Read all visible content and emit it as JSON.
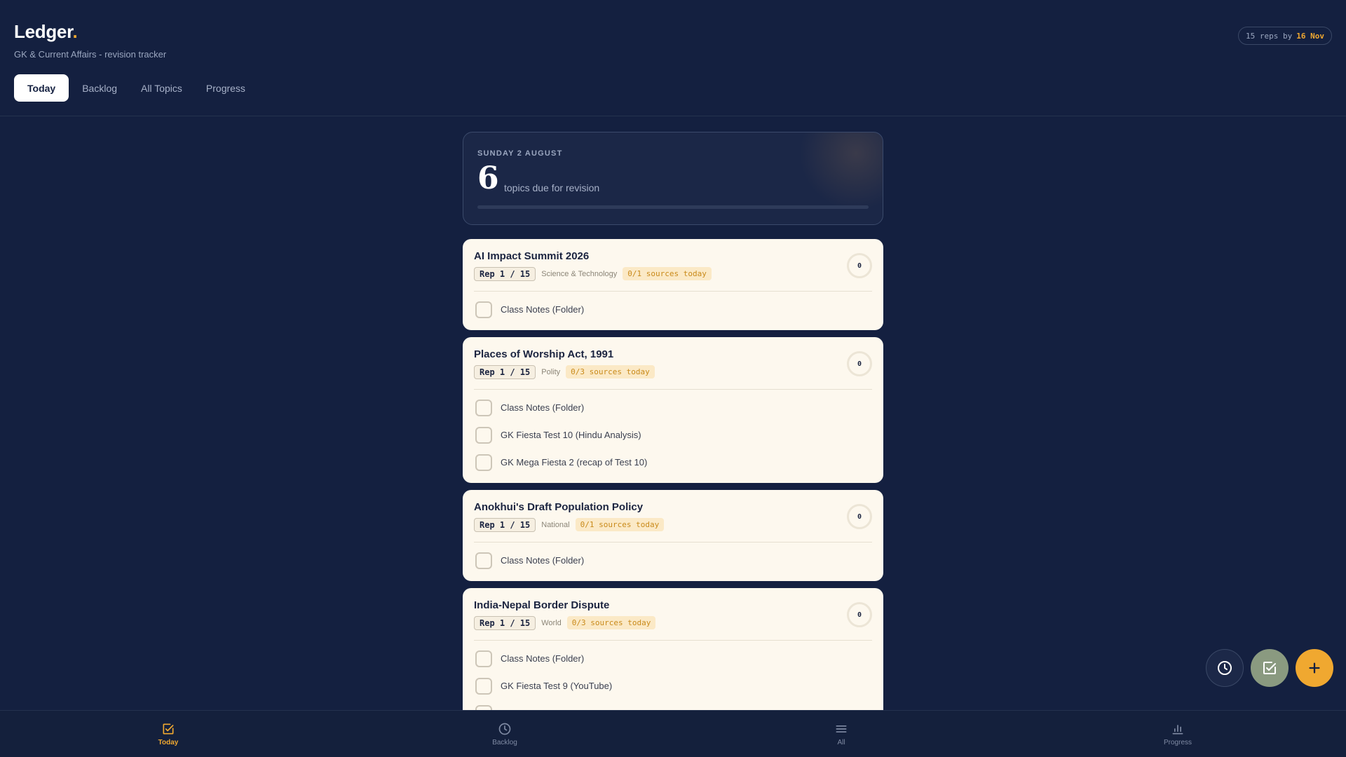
{
  "header": {
    "brand": "Ledger",
    "brand_dot": ".",
    "subtitle": "GK & Current Affairs - revision tracker",
    "reps_prefix": "15 reps by",
    "reps_date": "16 Nov",
    "tabs": [
      {
        "label": "Today",
        "active": true
      },
      {
        "label": "Backlog",
        "active": false
      },
      {
        "label": "All Topics",
        "active": false
      },
      {
        "label": "Progress",
        "active": false
      }
    ]
  },
  "summary": {
    "date": "SUNDAY 2 AUGUST",
    "count": "6",
    "label": "topics due for revision",
    "progress": 0
  },
  "topics": [
    {
      "title": "AI Impact Summit 2026",
      "rep": "Rep 1 / 15",
      "category": "Science & Technology",
      "sources_today": "0/1 sources today",
      "done_count": "0",
      "sources": [
        "Class Notes (Folder)"
      ]
    },
    {
      "title": "Places of Worship Act, 1991",
      "rep": "Rep 1 / 15",
      "category": "Polity",
      "sources_today": "0/3 sources today",
      "done_count": "0",
      "sources": [
        "Class Notes (Folder)",
        "GK Fiesta Test 10 (Hindu Analysis)",
        "GK Mega Fiesta 2 (recap of Test 10)"
      ]
    },
    {
      "title": "Anokhui's Draft Population Policy",
      "rep": "Rep 1 / 15",
      "category": "National",
      "sources_today": "0/1 sources today",
      "done_count": "0",
      "sources": [
        "Class Notes (Folder)"
      ]
    },
    {
      "title": "India-Nepal Border Dispute",
      "rep": "Rep 1 / 15",
      "category": "World",
      "sources_today": "0/3 sources today",
      "done_count": "0",
      "sources": [
        "Class Notes (Folder)",
        "GK Fiesta Test 9 (YouTube)",
        ""
      ]
    }
  ],
  "fabs": {
    "history_icon": "clock-icon",
    "done_icon": "check-square-icon",
    "add_icon": "plus-icon"
  },
  "bottom_nav": [
    {
      "label": "Today",
      "icon": "check-square-icon",
      "active": true
    },
    {
      "label": "Backlog",
      "icon": "clock-icon",
      "active": false
    },
    {
      "label": "All",
      "icon": "menu-icon",
      "active": false
    },
    {
      "label": "Progress",
      "icon": "bar-chart-icon",
      "active": false
    }
  ],
  "colors": {
    "background": "#142040",
    "accent": "#f0a830",
    "card": "#fdf8ee"
  }
}
